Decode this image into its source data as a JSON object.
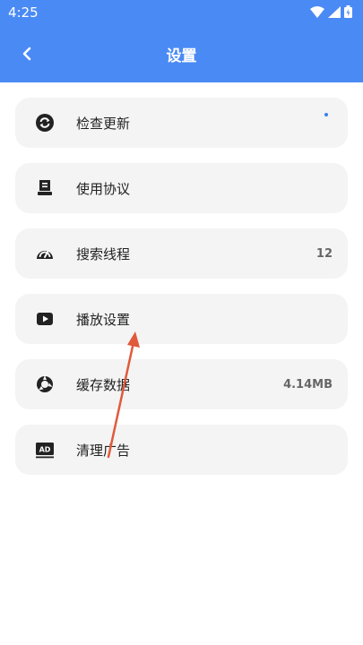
{
  "status_bar": {
    "time": "4:25"
  },
  "header": {
    "title": "设置"
  },
  "colors": {
    "primary": "#4a8af4",
    "item_bg": "#f4f4f4",
    "annotation_arrow": "#e05a3c"
  },
  "settings": [
    {
      "label": "检查更新",
      "icon": "sync-icon",
      "value": ""
    },
    {
      "label": "使用协议",
      "icon": "document-icon",
      "value": ""
    },
    {
      "label": "搜索线程",
      "icon": "speedometer-icon",
      "value": "12"
    },
    {
      "label": "播放设置",
      "icon": "play-icon",
      "value": ""
    },
    {
      "label": "缓存数据",
      "icon": "cache-icon",
      "value": "4.14MB"
    },
    {
      "label": "清理广告",
      "icon": "ad-icon",
      "value": ""
    }
  ]
}
